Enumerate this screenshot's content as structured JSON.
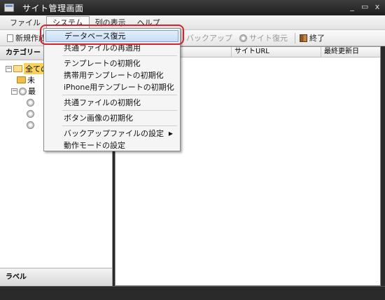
{
  "window": {
    "title": "サイト管理画面",
    "minimize_label": "_",
    "restore_label": "▭",
    "close_label": "x"
  },
  "menubar": {
    "items": [
      "ファイル",
      "システム",
      "列の表示",
      "ヘルプ"
    ]
  },
  "toolbar": {
    "new_label": "新規作成",
    "backup_label": "バックアップ",
    "site_restore_label": "サイト復元",
    "exit_label": "終了"
  },
  "left_panel": {
    "header": "カテゴリー",
    "tree": [
      {
        "label": "全ての",
        "selected": true
      },
      {
        "label": "未"
      },
      {
        "label": "最"
      }
    ],
    "footer": "ラベル"
  },
  "grid": {
    "columns": [
      "",
      "サイトURL",
      "最終更新日"
    ]
  },
  "dropdown": {
    "items": [
      {
        "label": "データベース復元",
        "highlight": true
      },
      {
        "label": "共通ファイルの再適用"
      },
      {
        "separator": true
      },
      {
        "label": "テンプレートの初期化"
      },
      {
        "label": "携帯用テンプレートの初期化"
      },
      {
        "label": "iPhone用テンプレートの初期化"
      },
      {
        "separator": true
      },
      {
        "label": "共通ファイルの初期化"
      },
      {
        "separator": true
      },
      {
        "label": "ボタン画像の初期化"
      },
      {
        "separator": true
      },
      {
        "label": "バックアップファイルの設定",
        "submenu": true
      },
      {
        "label": "動作モードの設定"
      }
    ]
  },
  "colors": {
    "highlight_border": "#d8222d",
    "selected_folder": "#f7d35a",
    "menu_hover": "#c9dcf5"
  }
}
